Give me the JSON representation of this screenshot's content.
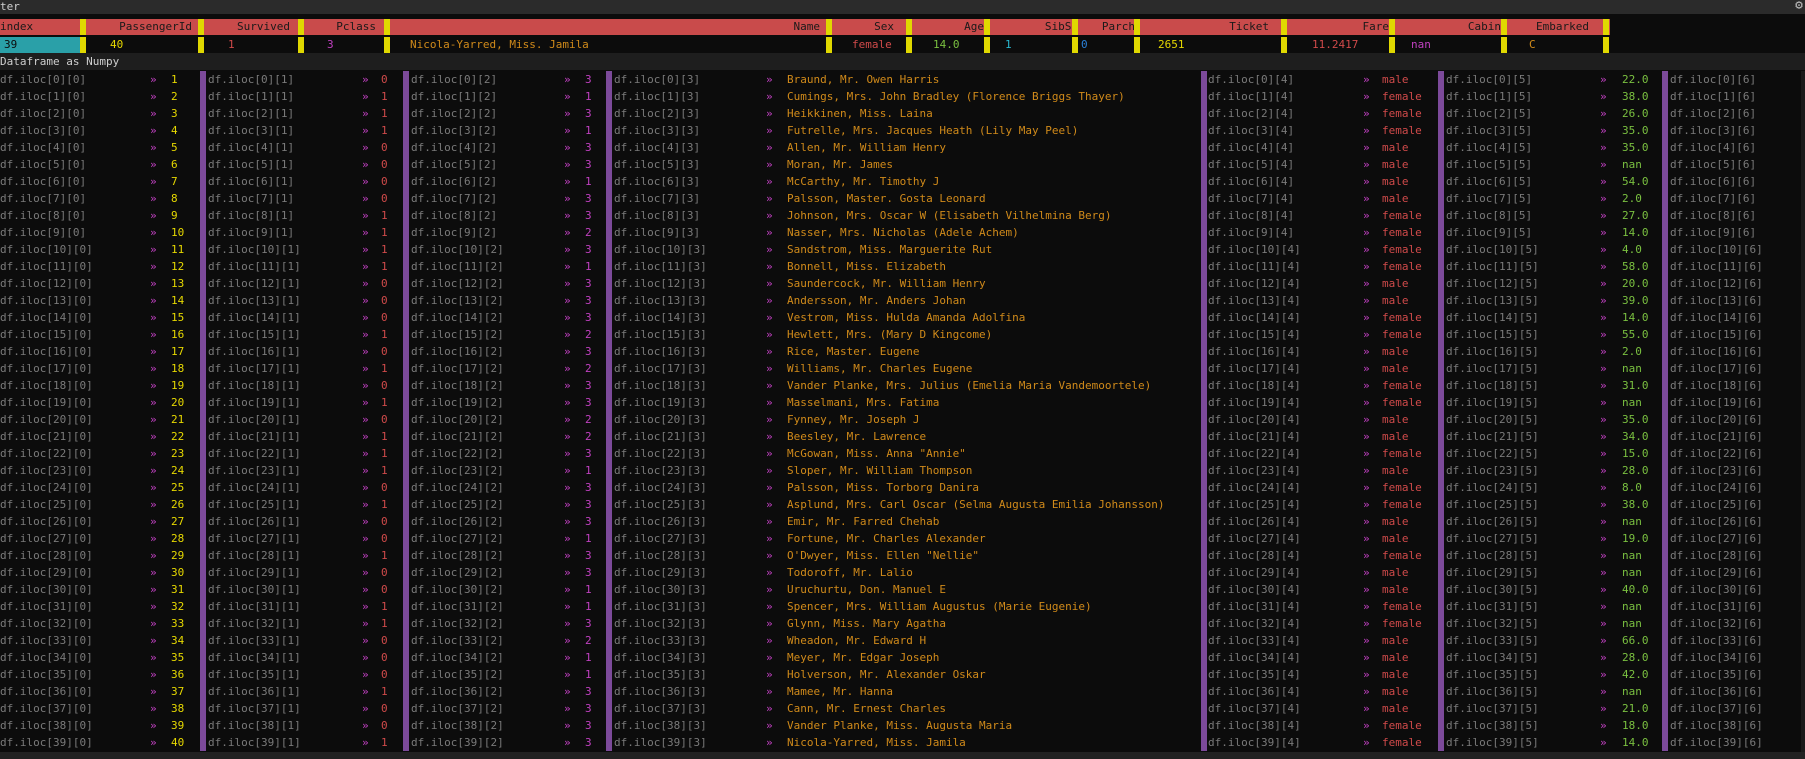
{
  "window": {
    "title": "ter",
    "settings_icon": "gear-icon"
  },
  "header": {
    "columns": [
      "index",
      "PassengerId",
      "Survived",
      "Pclass",
      "Name",
      "Sex",
      "Age",
      "SibSp",
      "Parch",
      "Ticket",
      "Fare",
      "Cabin",
      "Embarked"
    ]
  },
  "selected_row": {
    "index": "39",
    "PassengerId": "40",
    "Survived": "1",
    "Pclass": "3",
    "Name": "Nicola-Yarred, Miss. Jamila",
    "Sex": "female",
    "Age": "14.0",
    "SibSp": "1",
    "Parch": "0",
    "Ticket": "2651",
    "Fare": "11.2417",
    "Cabin": "nan",
    "Embarked": "C"
  },
  "section_title": "Dataframe as Numpy",
  "arrow_glyph": "»",
  "rows": [
    {
      "i": 0,
      "pid": "1",
      "surv": "0",
      "pcl": "3",
      "name": "Braund, Mr. Owen Harris",
      "sex": "male",
      "age": "22.0"
    },
    {
      "i": 1,
      "pid": "2",
      "surv": "1",
      "pcl": "1",
      "name": "Cumings, Mrs. John Bradley (Florence Briggs Thayer)",
      "sex": "female",
      "age": "38.0"
    },
    {
      "i": 2,
      "pid": "3",
      "surv": "1",
      "pcl": "3",
      "name": "Heikkinen, Miss. Laina",
      "sex": "female",
      "age": "26.0"
    },
    {
      "i": 3,
      "pid": "4",
      "surv": "1",
      "pcl": "1",
      "name": "Futrelle, Mrs. Jacques Heath (Lily May Peel)",
      "sex": "female",
      "age": "35.0"
    },
    {
      "i": 4,
      "pid": "5",
      "surv": "0",
      "pcl": "3",
      "name": "Allen, Mr. William Henry",
      "sex": "male",
      "age": "35.0"
    },
    {
      "i": 5,
      "pid": "6",
      "surv": "0",
      "pcl": "3",
      "name": "Moran, Mr. James",
      "sex": "male",
      "age": "nan"
    },
    {
      "i": 6,
      "pid": "7",
      "surv": "0",
      "pcl": "1",
      "name": "McCarthy, Mr. Timothy J",
      "sex": "male",
      "age": "54.0"
    },
    {
      "i": 7,
      "pid": "8",
      "surv": "0",
      "pcl": "3",
      "name": "Palsson, Master. Gosta Leonard",
      "sex": "male",
      "age": "2.0"
    },
    {
      "i": 8,
      "pid": "9",
      "surv": "1",
      "pcl": "3",
      "name": "Johnson, Mrs. Oscar W (Elisabeth Vilhelmina Berg)",
      "sex": "female",
      "age": "27.0"
    },
    {
      "i": 9,
      "pid": "10",
      "surv": "1",
      "pcl": "2",
      "name": "Nasser, Mrs. Nicholas (Adele Achem)",
      "sex": "female",
      "age": "14.0"
    },
    {
      "i": 10,
      "pid": "11",
      "surv": "1",
      "pcl": "3",
      "name": "Sandstrom, Miss. Marguerite Rut",
      "sex": "female",
      "age": "4.0"
    },
    {
      "i": 11,
      "pid": "12",
      "surv": "1",
      "pcl": "1",
      "name": "Bonnell, Miss. Elizabeth",
      "sex": "female",
      "age": "58.0"
    },
    {
      "i": 12,
      "pid": "13",
      "surv": "0",
      "pcl": "3",
      "name": "Saundercock, Mr. William Henry",
      "sex": "male",
      "age": "20.0"
    },
    {
      "i": 13,
      "pid": "14",
      "surv": "0",
      "pcl": "3",
      "name": "Andersson, Mr. Anders Johan",
      "sex": "male",
      "age": "39.0"
    },
    {
      "i": 14,
      "pid": "15",
      "surv": "0",
      "pcl": "3",
      "name": "Vestrom, Miss. Hulda Amanda Adolfina",
      "sex": "female",
      "age": "14.0"
    },
    {
      "i": 15,
      "pid": "16",
      "surv": "1",
      "pcl": "2",
      "name": "Hewlett, Mrs. (Mary D Kingcome)",
      "sex": "female",
      "age": "55.0"
    },
    {
      "i": 16,
      "pid": "17",
      "surv": "0",
      "pcl": "3",
      "name": "Rice, Master. Eugene",
      "sex": "male",
      "age": "2.0"
    },
    {
      "i": 17,
      "pid": "18",
      "surv": "1",
      "pcl": "2",
      "name": "Williams, Mr. Charles Eugene",
      "sex": "male",
      "age": "nan"
    },
    {
      "i": 18,
      "pid": "19",
      "surv": "0",
      "pcl": "3",
      "name": "Vander Planke, Mrs. Julius (Emelia Maria Vandemoortele)",
      "sex": "female",
      "age": "31.0"
    },
    {
      "i": 19,
      "pid": "20",
      "surv": "1",
      "pcl": "3",
      "name": "Masselmani, Mrs. Fatima",
      "sex": "female",
      "age": "nan"
    },
    {
      "i": 20,
      "pid": "21",
      "surv": "0",
      "pcl": "2",
      "name": "Fynney, Mr. Joseph J",
      "sex": "male",
      "age": "35.0"
    },
    {
      "i": 21,
      "pid": "22",
      "surv": "1",
      "pcl": "2",
      "name": "Beesley, Mr. Lawrence",
      "sex": "male",
      "age": "34.0"
    },
    {
      "i": 22,
      "pid": "23",
      "surv": "1",
      "pcl": "3",
      "name": "McGowan, Miss. Anna \"Annie\"",
      "sex": "female",
      "age": "15.0"
    },
    {
      "i": 23,
      "pid": "24",
      "surv": "1",
      "pcl": "1",
      "name": "Sloper, Mr. William Thompson",
      "sex": "male",
      "age": "28.0"
    },
    {
      "i": 24,
      "pid": "25",
      "surv": "0",
      "pcl": "3",
      "name": "Palsson, Miss. Torborg Danira",
      "sex": "female",
      "age": "8.0"
    },
    {
      "i": 25,
      "pid": "26",
      "surv": "1",
      "pcl": "3",
      "name": "Asplund, Mrs. Carl Oscar (Selma Augusta Emilia Johansson)",
      "sex": "female",
      "age": "38.0"
    },
    {
      "i": 26,
      "pid": "27",
      "surv": "0",
      "pcl": "3",
      "name": "Emir, Mr. Farred Chehab",
      "sex": "male",
      "age": "nan"
    },
    {
      "i": 27,
      "pid": "28",
      "surv": "0",
      "pcl": "1",
      "name": "Fortune, Mr. Charles Alexander",
      "sex": "male",
      "age": "19.0"
    },
    {
      "i": 28,
      "pid": "29",
      "surv": "1",
      "pcl": "3",
      "name": "O'Dwyer, Miss. Ellen \"Nellie\"",
      "sex": "female",
      "age": "nan"
    },
    {
      "i": 29,
      "pid": "30",
      "surv": "0",
      "pcl": "3",
      "name": "Todoroff, Mr. Lalio",
      "sex": "male",
      "age": "nan"
    },
    {
      "i": 30,
      "pid": "31",
      "surv": "0",
      "pcl": "1",
      "name": "Uruchurtu, Don. Manuel E",
      "sex": "male",
      "age": "40.0"
    },
    {
      "i": 31,
      "pid": "32",
      "surv": "1",
      "pcl": "1",
      "name": "Spencer, Mrs. William Augustus (Marie Eugenie)",
      "sex": "female",
      "age": "nan"
    },
    {
      "i": 32,
      "pid": "33",
      "surv": "1",
      "pcl": "3",
      "name": "Glynn, Miss. Mary Agatha",
      "sex": "female",
      "age": "nan"
    },
    {
      "i": 33,
      "pid": "34",
      "surv": "0",
      "pcl": "2",
      "name": "Wheadon, Mr. Edward H",
      "sex": "male",
      "age": "66.0"
    },
    {
      "i": 34,
      "pid": "35",
      "surv": "0",
      "pcl": "1",
      "name": "Meyer, Mr. Edgar Joseph",
      "sex": "male",
      "age": "28.0"
    },
    {
      "i": 35,
      "pid": "36",
      "surv": "0",
      "pcl": "1",
      "name": "Holverson, Mr. Alexander Oskar",
      "sex": "male",
      "age": "42.0"
    },
    {
      "i": 36,
      "pid": "37",
      "surv": "1",
      "pcl": "3",
      "name": "Mamee, Mr. Hanna",
      "sex": "male",
      "age": "nan"
    },
    {
      "i": 37,
      "pid": "38",
      "surv": "0",
      "pcl": "3",
      "name": "Cann, Mr. Ernest Charles",
      "sex": "male",
      "age": "21.0"
    },
    {
      "i": 38,
      "pid": "39",
      "surv": "0",
      "pcl": "3",
      "name": "Vander Planke, Miss. Augusta Maria",
      "sex": "female",
      "age": "18.0"
    },
    {
      "i": 39,
      "pid": "40",
      "surv": "1",
      "pcl": "3",
      "name": "Nicola-Yarred, Miss. Jamila",
      "sex": "female",
      "age": "14.0"
    }
  ],
  "colors": {
    "header_bg": "#c94b4b",
    "separator": "#e0d800",
    "name": "#d08a1a",
    "number": "#e6d800",
    "sex": "#d04a4a",
    "age": "#7ac040",
    "class": "#c040c0",
    "index_bg": "#2aa0a8"
  }
}
